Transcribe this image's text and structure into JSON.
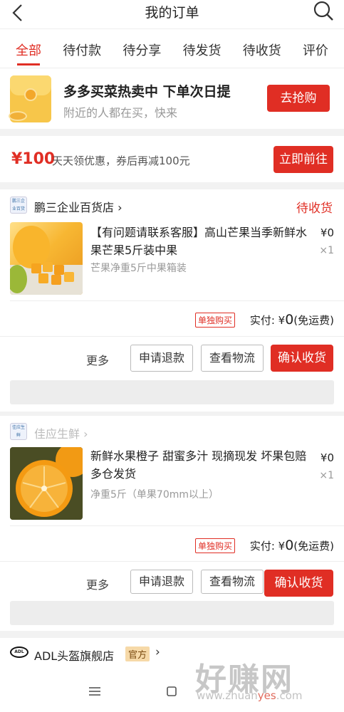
{
  "header": {
    "title": "我的订单"
  },
  "tabs": [
    "全部",
    "待付款",
    "待分享",
    "待发货",
    "待收货",
    "评价"
  ],
  "promo": {
    "title": "多多买菜热卖中 下单次日提",
    "subtitle": "附近的人都在买，快来",
    "button": "去抢购"
  },
  "coupon": {
    "amount": "¥100",
    "text": "天天领优惠，券后再减100元",
    "button": "立即前往"
  },
  "orders": [
    {
      "shop_logo_text": "鹏三企业百货店",
      "shop": "鹏三企业百货店 ›",
      "status": "待收货",
      "title": "【有问题请联系客服】高山芒果当季新鲜水果芒果5斤装中果",
      "spec": "芒果净重5斤中果箱装",
      "price": "¥0",
      "qty": "×1",
      "tag": "单独购买",
      "pay_label": "实付: ",
      "pay_currency": "¥",
      "pay_amount": "0",
      "pay_note": "(免运费)",
      "more": "更多",
      "btn_refund": "申请退款",
      "btn_logistics": "查看物流",
      "btn_confirm": "确认收货"
    },
    {
      "shop_logo_text": "佳应生鲜",
      "shop": "佳应生鲜 ›",
      "status": "",
      "title": "新鲜水果橙子 甜蜜多汁 现摘现发 坏果包赔多仓发货",
      "spec": "净重5斤（单果70mm以上）",
      "price": "¥0",
      "qty": "×1",
      "tag": "单独购买",
      "pay_label": "实付: ",
      "pay_currency": "¥",
      "pay_amount": "0",
      "pay_note": "(免运费)",
      "more": "更多",
      "btn_refund": "申请退款",
      "btn_logistics": "查看物流",
      "btn_confirm": "确认收货"
    },
    {
      "shop_logo_text": "ADL",
      "shop": "ADL头盔旗舰店",
      "badge": "官方",
      "arrow": "›"
    }
  ],
  "watermark": {
    "main": "好赚网",
    "url_pre": "www.zhuan",
    "url_hl": "yes",
    "url_post": ".com"
  },
  "icons": {
    "back": "back-arrow-icon",
    "search": "search-icon",
    "menu": "menu-icon",
    "home": "home-square-icon",
    "back_nav": "back-nav-icon"
  },
  "colors": {
    "accent": "#e02e24",
    "badge_bg": "#f6d9a8"
  }
}
